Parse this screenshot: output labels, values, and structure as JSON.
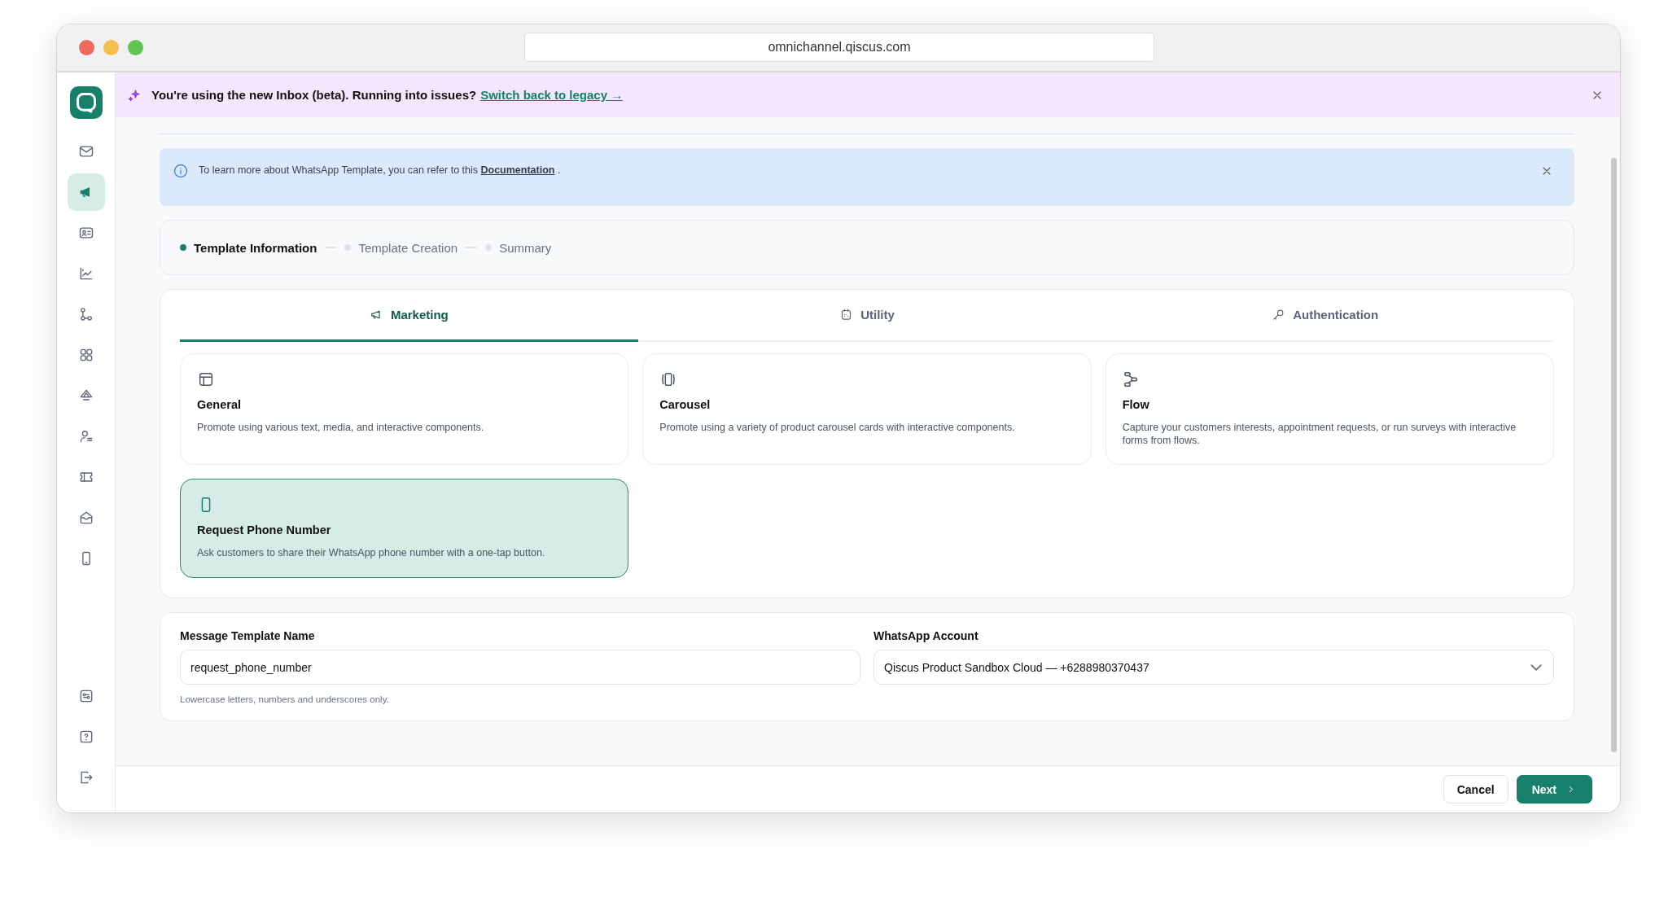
{
  "browser": {
    "url": "omnichannel.qiscus.com"
  },
  "sidebar": {
    "items": [
      {
        "selected": false
      },
      {
        "selected": true
      },
      {
        "selected": false
      },
      {
        "selected": false
      },
      {
        "selected": false
      },
      {
        "selected": false
      },
      {
        "selected": false
      },
      {
        "selected": false
      },
      {
        "selected": false
      },
      {
        "selected": false
      },
      {
        "selected": false
      }
    ],
    "bottom_items": [
      {
        "selected": false
      },
      {
        "selected": false
      },
      {
        "selected": false
      }
    ]
  },
  "banner": {
    "text": "You're using the new Inbox (beta). Running into issues?",
    "link": "Switch back to legacy →"
  },
  "info": {
    "text": "To learn more about WhatsApp Template, you can refer to this",
    "link": "Documentation",
    "suffix": "."
  },
  "steps": [
    {
      "label": "Template Information",
      "selected": true
    },
    {
      "label": "Template Creation",
      "selected": false
    },
    {
      "label": "Summary",
      "selected": false
    }
  ],
  "tabs": [
    {
      "label": "Marketing",
      "selected": true
    },
    {
      "label": "Utility",
      "selected": false
    },
    {
      "label": "Authentication",
      "selected": false
    }
  ],
  "template_types": [
    {
      "title": "General",
      "description": "Promote using various text, media, and interactive components.",
      "selected": false
    },
    {
      "title": "Carousel",
      "description": "Promote using a variety of product carousel cards with interactive components.",
      "selected": false
    },
    {
      "title": "Flow",
      "description": "Capture your customers interests, appointment requests, or run surveys with interactive forms from flows.",
      "selected": false
    },
    {
      "title": "Request Phone Number",
      "description": "Ask customers to share their WhatsApp phone number with a one-tap button.",
      "selected": true
    }
  ],
  "form": {
    "name": {
      "label": "Message Template Name",
      "value": "request_phone_number",
      "hint": "Lowercase letters, numbers and underscores only."
    },
    "account": {
      "label": "WhatsApp Account",
      "value": "Qiscus Product Sandbox Cloud — +6288980370437"
    }
  },
  "buttons": [
    {
      "label": "Cancel",
      "kind": "secondary"
    },
    {
      "label": "Next",
      "kind": "primary"
    }
  ]
}
